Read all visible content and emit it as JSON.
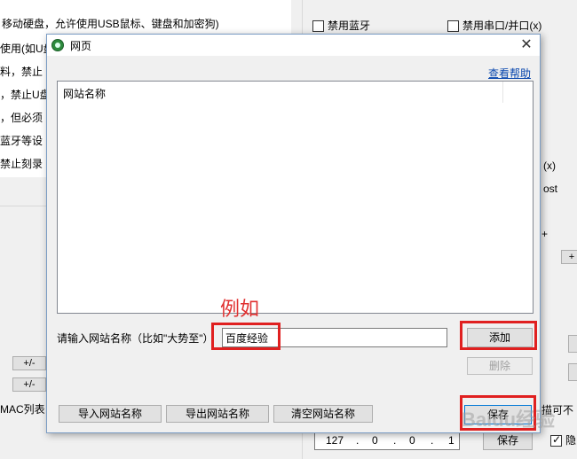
{
  "background": {
    "left_lines": [
      "移动硬盘，允许使用USB鼠标、键盘和加密狗)",
      "使用(如U盘",
      "料，禁止",
      "，禁止U盘",
      "，但必须",
      "蓝牙等设",
      "禁止刻录"
    ],
    "top_checkbox_bluetooth": "禁用蓝牙",
    "top_checkbox_serial": "禁用串口/并口(x)",
    "right_partial_1": "(x)",
    "right_partial_2": "ost",
    "right_partial_3": "+",
    "plus_minus_1": "+/-",
    "plus_minus_2": "+/-",
    "mac_list_label": "MAC列表",
    "right_partial_4": "描可不",
    "ip_address": [
      "127",
      "0",
      "0",
      "1"
    ],
    "save_button": "保存",
    "right_checkbox_label": "隐"
  },
  "dialog": {
    "title": "网页",
    "help_link": "查看帮助",
    "list_column_header": "网站名称",
    "input_prompt": "请输入网站名称（比如\"大势至\"）",
    "input_value": "百度经验",
    "add_button": "添加",
    "delete_button": "删除",
    "import_button": "导入网站名称",
    "export_button": "导出网站名称",
    "clear_button": "清空网站名称",
    "save_button": "保存"
  },
  "annotations": {
    "example_label": "例如",
    "watermark": "Baidu经验"
  },
  "colors": {
    "annotation_red": "#e02020",
    "link_blue": "#0645ad",
    "dialog_bg": "#f0f0f0"
  }
}
